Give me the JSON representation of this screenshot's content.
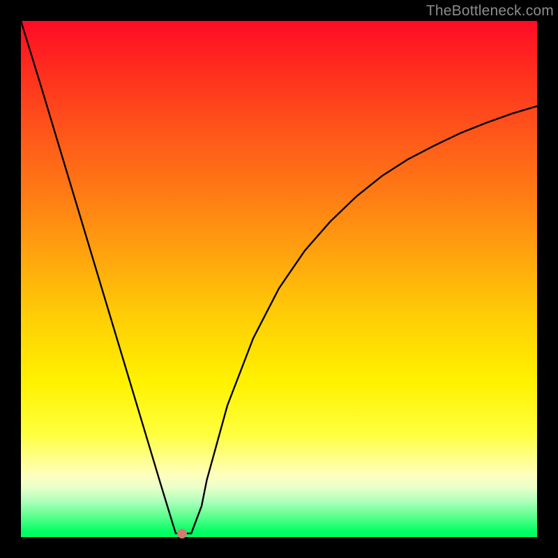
{
  "watermark": "TheBottleneck.com",
  "colors": {
    "frame": "#000000",
    "line": "#000000",
    "marker": "#d57a6e",
    "watermark": "#8c8c8c"
  },
  "marker": {
    "x_frac": 0.312,
    "y_frac": 0.993
  },
  "chart_data": {
    "type": "line",
    "title": "",
    "xlabel": "",
    "ylabel": "",
    "xlim": [
      0,
      1
    ],
    "ylim": [
      0,
      1
    ],
    "grid": false,
    "legend": false,
    "series": [
      {
        "name": "curve",
        "x": [
          0.0,
          0.04,
          0.08,
          0.12,
          0.16,
          0.2,
          0.24,
          0.27,
          0.295,
          0.3,
          0.31,
          0.33,
          0.35,
          0.36,
          0.4,
          0.45,
          0.5,
          0.55,
          0.6,
          0.65,
          0.7,
          0.75,
          0.8,
          0.85,
          0.9,
          0.95,
          1.0
        ],
        "y": [
          1.0,
          0.87,
          0.737,
          0.604,
          0.471,
          0.338,
          0.205,
          0.105,
          0.023,
          0.007,
          0.007,
          0.007,
          0.06,
          0.11,
          0.255,
          0.385,
          0.482,
          0.555,
          0.612,
          0.66,
          0.7,
          0.732,
          0.758,
          0.782,
          0.802,
          0.82,
          0.835
        ],
        "marker_point": {
          "x": 0.312,
          "y": 0.007
        }
      }
    ]
  }
}
